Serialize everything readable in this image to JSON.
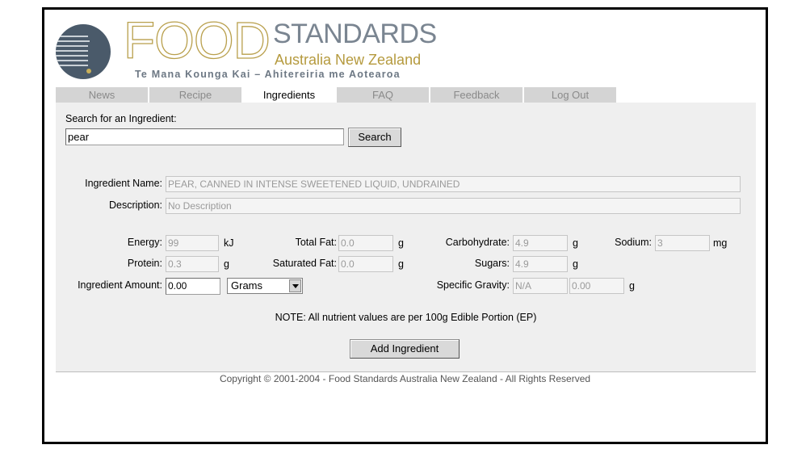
{
  "brand": {
    "food": "FOOD",
    "standards": "STANDARDS",
    "subtitle": "Australia New Zealand",
    "maori": "Te Mana Kounga Kai – Ahitereiria me Aotearoa"
  },
  "tabs": [
    {
      "label": "News",
      "active": false
    },
    {
      "label": "Recipe",
      "active": false
    },
    {
      "label": "Ingredients",
      "active": true
    },
    {
      "label": "FAQ",
      "active": false
    },
    {
      "label": "Feedback",
      "active": false
    },
    {
      "label": "Log Out",
      "active": false
    }
  ],
  "search": {
    "label": "Search for an Ingredient:",
    "value": "pear",
    "button": "Search"
  },
  "ingredient": {
    "name_label": "Ingredient Name:",
    "name_value": "PEAR, CANNED IN INTENSE SWEETENED LIQUID, UNDRAINED",
    "desc_label": "Description:",
    "desc_value": "No Description"
  },
  "nutrients": {
    "energy": {
      "label": "Energy:",
      "value": "99",
      "unit": "kJ"
    },
    "total_fat": {
      "label": "Total Fat:",
      "value": "0.0",
      "unit": "g"
    },
    "carbohydrate": {
      "label": "Carbohydrate:",
      "value": "4.9",
      "unit": "g"
    },
    "sodium": {
      "label": "Sodium:",
      "value": "3",
      "unit": "mg"
    },
    "protein": {
      "label": "Protein:",
      "value": "0.3",
      "unit": "g"
    },
    "saturated_fat": {
      "label": "Saturated Fat:",
      "value": "0.0",
      "unit": "g"
    },
    "sugars": {
      "label": "Sugars:",
      "value": "4.9",
      "unit": "g"
    }
  },
  "amount": {
    "label": "Ingredient Amount:",
    "value": "0.00",
    "unit_selected": "Grams"
  },
  "specific_gravity": {
    "label": "Specific Gravity:",
    "value": "N/A",
    "grams_value": "0.00",
    "unit": "g"
  },
  "note": "NOTE: All nutrient values are per 100g Edible Portion (EP)",
  "add_button": "Add Ingredient",
  "copyright": "Copyright © 2001-2004 - Food Standards Australia New Zealand - All Rights Reserved"
}
